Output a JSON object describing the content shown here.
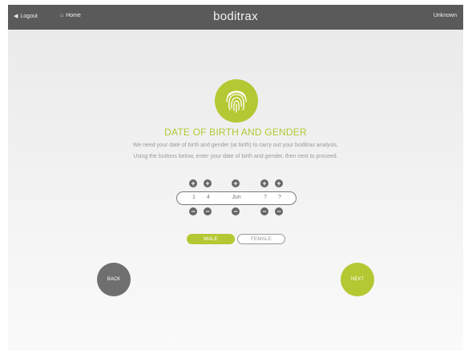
{
  "topbar": {
    "logout_label": "Logout",
    "home_label": "Home",
    "brand": "boditrax",
    "user_label": "Unknown"
  },
  "screen": {
    "title": "DATE OF BIRTH AND GENDER",
    "description_line1": "We need your date of birth and gender (at birth) to carry out your boditrax analysis.",
    "description_line2": "Using the buttons below, enter your date of birth and gender, then next to proceed."
  },
  "date_of_birth": {
    "day_tens": "1",
    "day_units": "4",
    "month": "Jun",
    "year_tens": "?",
    "year_units": "?"
  },
  "gender": {
    "male_label": "MALE",
    "female_label": "FEMALE",
    "selected": "MALE"
  },
  "navigation": {
    "back_label": "BACK",
    "next_label": "NEXT"
  },
  "colors": {
    "accent": "#b4c833",
    "topbar": "#5a5a5a",
    "back_button": "#6f6f6f"
  },
  "icons": {
    "logout": "triangle-left-icon",
    "home": "home-icon",
    "header": "fingerprint-icon",
    "increment": "plus-icon",
    "decrement": "minus-icon"
  }
}
